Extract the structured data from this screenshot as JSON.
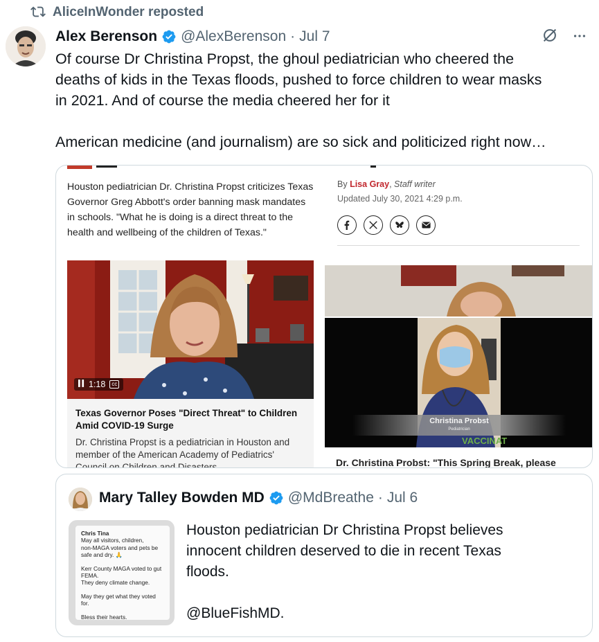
{
  "repost": {
    "label": "AliceInWonder reposted",
    "icon": "repost-icon"
  },
  "post": {
    "author_name": "Alex Berenson",
    "handle": "@AlexBerenson",
    "separator": "·",
    "date": "Jul 7",
    "verified_icon": "verified-badge-icon",
    "actions_icons": [
      "grok-icon",
      "more-icon"
    ],
    "text_lines": [
      "Of course Dr Christina Propst, the ghoul pediatrician who cheered the",
      "deaths of kids in the Texas floods, pushed to force children to wear masks",
      "in 2021. And of course the media cheered her for it",
      "American medicine (and journalism) are so sick and politicized right now…"
    ]
  },
  "media": {
    "left": {
      "blurb": "Houston pediatrician Dr. Christina Propst criticizes Texas Governor Greg Abbott's order banning mask mandates in schools. \"What he is doing is a direct threat to the health and wellbeing of the children of Texas.\"",
      "video_time": "1:18",
      "cc_label": "cc",
      "video_title": "Texas Governor Poses \"Direct Threat\" to Children Amid COVID-19 Surge",
      "video_desc": "Dr. Christina Propst is a pediatrician in Houston and member of the American Academy of Pediatrics' Council on Children and Disasters."
    },
    "right": {
      "by_prefix": "By",
      "author": "Lisa Gray",
      "role": "Staff writer",
      "updated": "Updated July 30, 2021 4:29 p.m.",
      "share_icons": [
        "facebook-icon",
        "x-icon",
        "bluesky-icon",
        "email-icon"
      ],
      "nameplate_name": "Christina Probst",
      "nameplate_role": "Pediatrician",
      "headline": "Dr. Christina Probst: \"This Spring Break, please"
    }
  },
  "quote": {
    "author_name": "Mary Talley Bowden MD",
    "handle": "@MdBreathe",
    "separator": "·",
    "date": "Jul 6",
    "text_lines": [
      "Houston pediatrician Dr Christina Propst believes",
      "innocent children deserved to die in recent Texas",
      "floods."
    ],
    "mention": "@BlueFishMD.",
    "note": {
      "title": "Chris Tina",
      "lines_1": [
        "May all visitors, children,",
        "non-MAGA voters and pets be",
        "safe and dry. 🙏"
      ],
      "lines_2": [
        "Kerr County MAGA voted to gut",
        "FEMA.",
        "They deny climate change."
      ],
      "lines_3": [
        "May they get what they voted for."
      ],
      "lines_4": [
        "Bless their hearts."
      ]
    }
  },
  "colors": {
    "text_primary": "#0f1419",
    "text_secondary": "#536471",
    "verified_blue": "#1d9bf0",
    "border": "#cfd9de",
    "byline_red": "#c1272d"
  }
}
